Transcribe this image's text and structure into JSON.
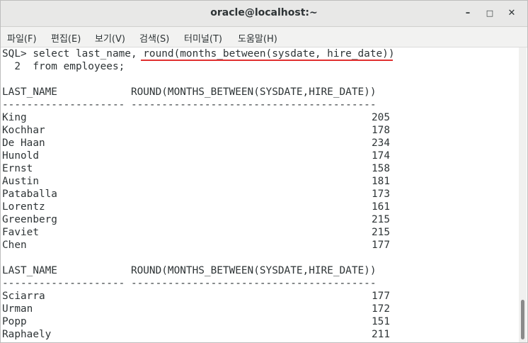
{
  "window": {
    "title": "oracle@localhost:~"
  },
  "controls": {
    "minimize": "–",
    "maximize": "□",
    "close": "✕"
  },
  "menu": [
    "파일(F)",
    "편집(E)",
    "보기(V)",
    "검색(S)",
    "터미널(T)",
    "도움말(H)"
  ],
  "terminal": {
    "command_line1": "SQL> select last_name, round(months_between(sysdate, hire_date))",
    "command_line2": "  2  from employees;",
    "header": "LAST_NAME            ROUND(MONTHS_BETWEEN(SYSDATE,HIRE_DATE))",
    "separator": "-------------------- ----------------------------------------",
    "block1": [
      {
        "name": "King",
        "months": "205"
      },
      {
        "name": "Kochhar",
        "months": "178"
      },
      {
        "name": "De Haan",
        "months": "234"
      },
      {
        "name": "Hunold",
        "months": "174"
      },
      {
        "name": "Ernst",
        "months": "158"
      },
      {
        "name": "Austin",
        "months": "181"
      },
      {
        "name": "Pataballa",
        "months": "173"
      },
      {
        "name": "Lorentz",
        "months": "161"
      },
      {
        "name": "Greenberg",
        "months": "215"
      },
      {
        "name": "Faviet",
        "months": "215"
      },
      {
        "name": "Chen",
        "months": "177"
      }
    ],
    "block2": [
      {
        "name": "Sciarra",
        "months": "177"
      },
      {
        "name": "Urman",
        "months": "172"
      },
      {
        "name": "Popp",
        "months": "151"
      },
      {
        "name": "Raphaely",
        "months": "211"
      }
    ]
  },
  "colors": {
    "annotation": "#e03030",
    "text": "#2e3436"
  }
}
